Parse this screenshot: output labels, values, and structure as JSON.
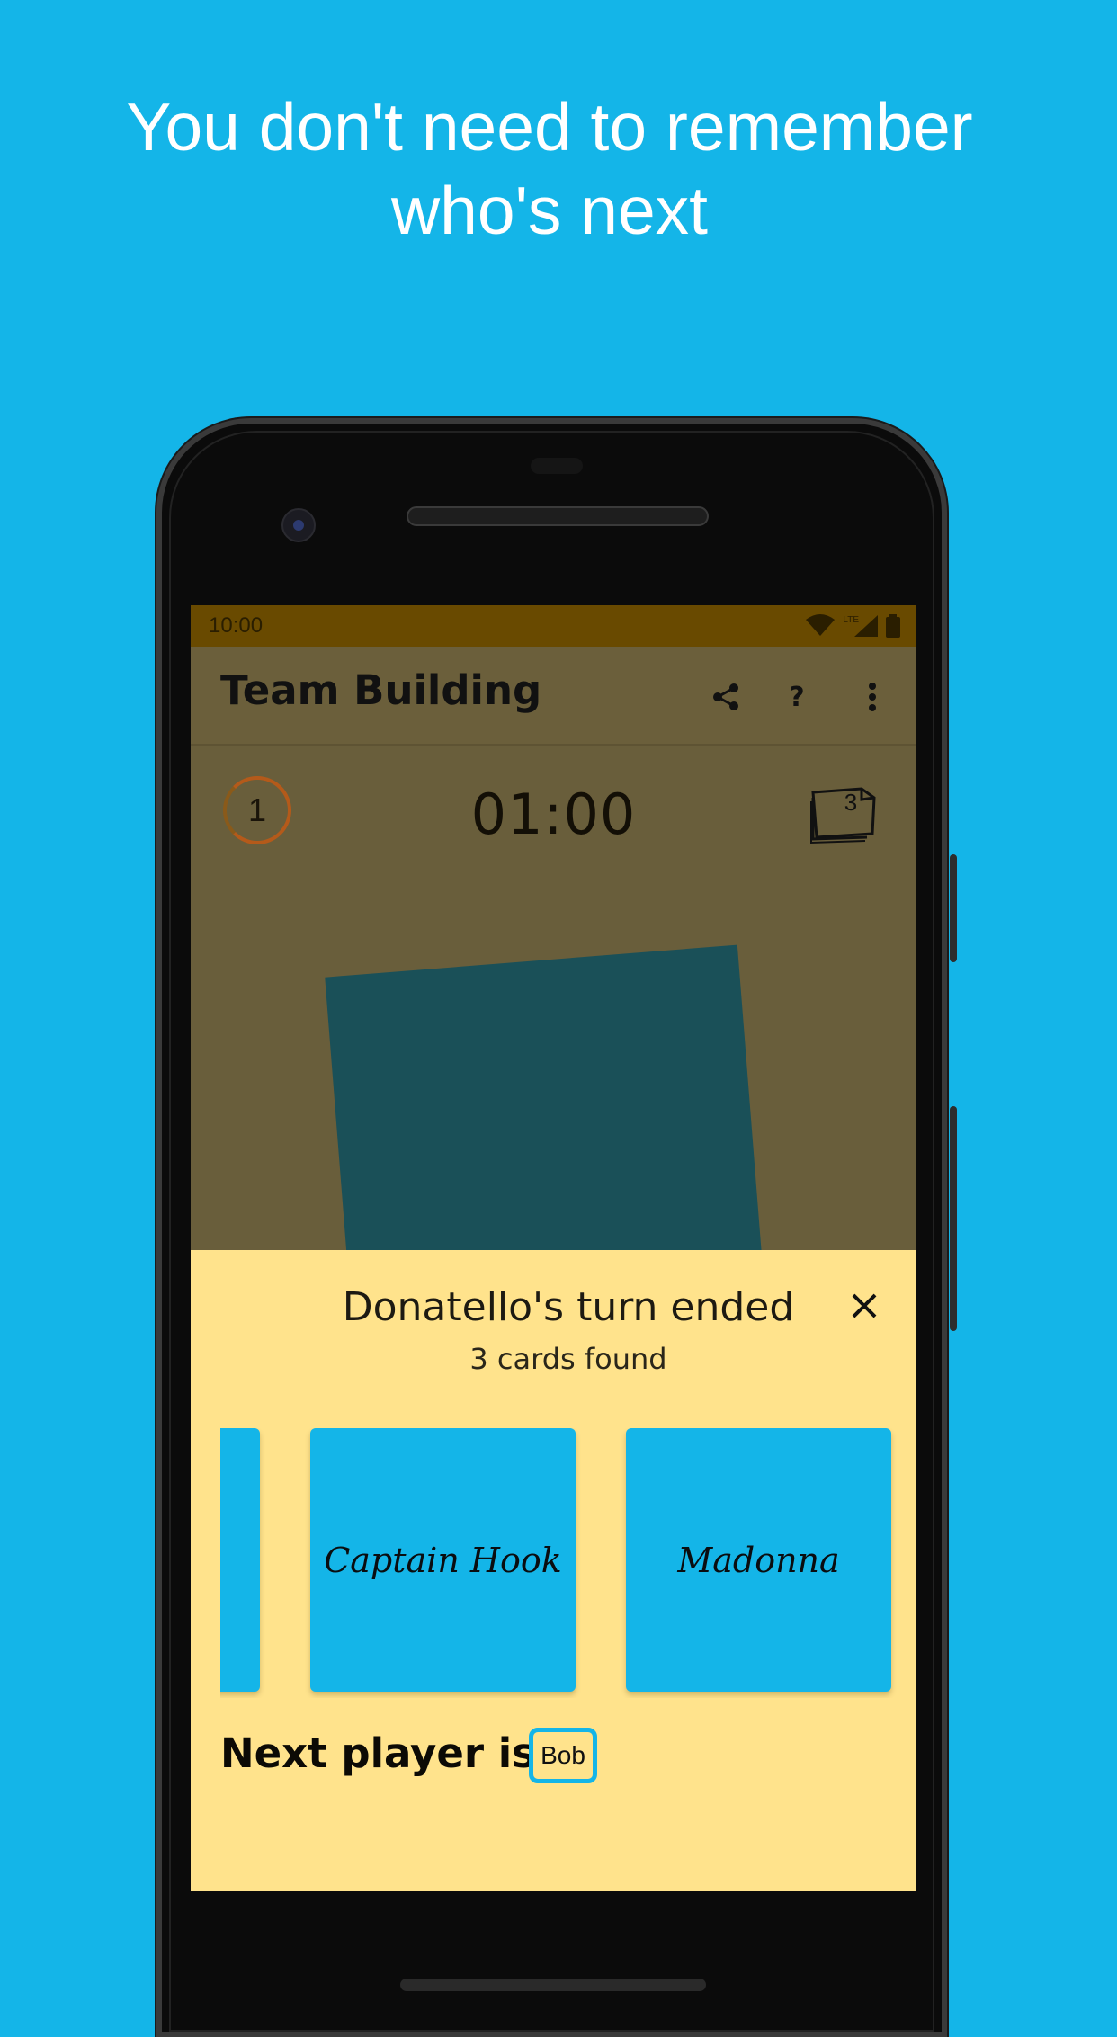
{
  "headline": "You don't need to remember who's next",
  "status_bar": {
    "time": "10:00",
    "icons": [
      "wifi-icon",
      "signal-icon",
      "battery-icon"
    ],
    "network_label": "LTE"
  },
  "app_bar": {
    "title": "Team Building",
    "actions": [
      {
        "name": "share-icon",
        "glyph": "share"
      },
      {
        "name": "help-icon",
        "glyph": "?"
      },
      {
        "name": "more-vert-icon",
        "glyph": "⋮"
      }
    ]
  },
  "game": {
    "round": "1",
    "timer": "01:00",
    "deck_count": "3"
  },
  "turn_sheet": {
    "title": "Donatello's turn ended",
    "subtitle": "3 cards found",
    "cards": [
      "",
      "Captain Hook",
      "Madonna"
    ],
    "next_label": "Next player is",
    "next_player": "Bob"
  },
  "colors": {
    "brand_blue": "#14b5e8",
    "sheet_yellow": "#ffe38c",
    "overlay_dim": "#695e3b",
    "status_bar": "#694a00",
    "round_ring": "#b45a1a"
  }
}
